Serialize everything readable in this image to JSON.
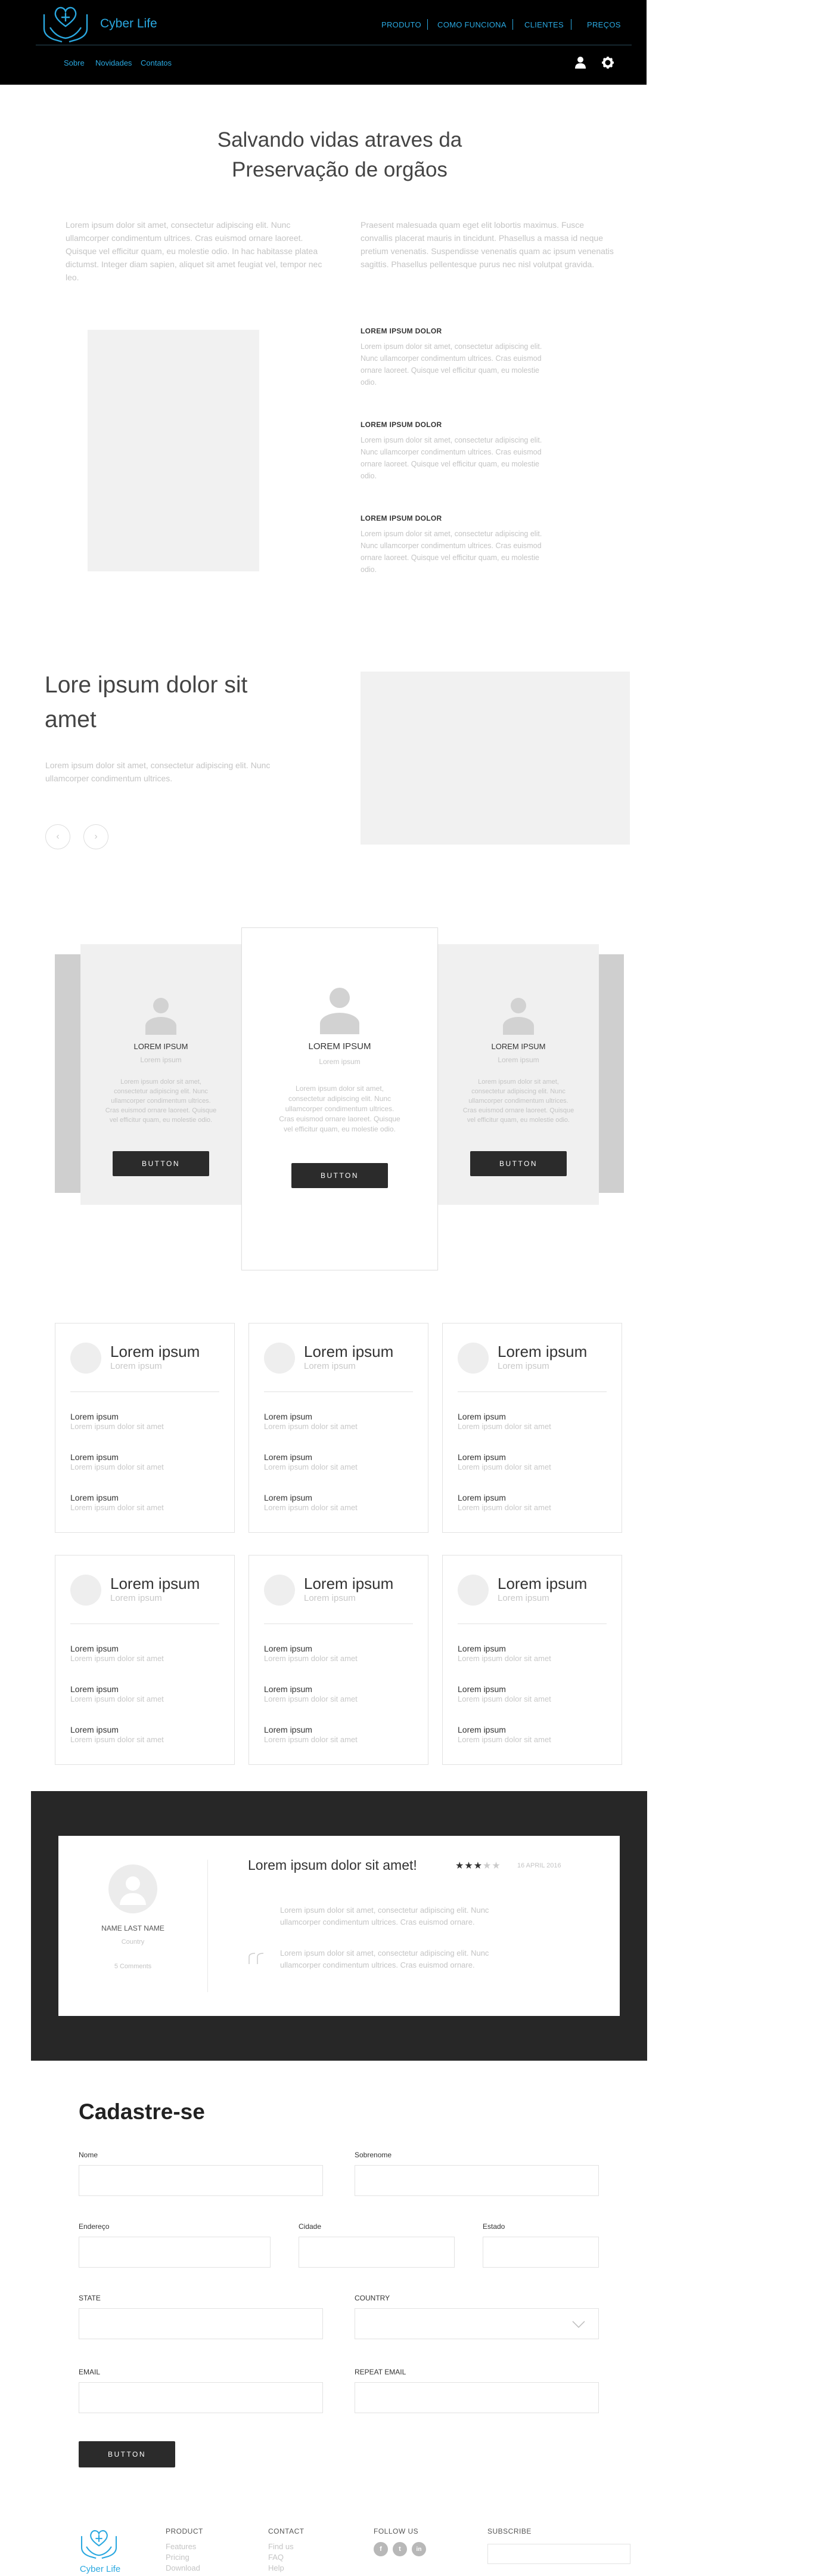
{
  "header": {
    "brand": "Cyber Life",
    "nav": [
      "PRODUTO",
      "COMO FUNCIONA",
      "CLIENTES",
      "PREÇOS"
    ],
    "subnav": [
      "Sobre",
      "Novidades",
      "Contatos"
    ],
    "icons": [
      "user-icon",
      "gear-icon"
    ],
    "accent": "#2aa8e0",
    "bg": "#000000"
  },
  "hero": {
    "title_line1": "Salvando vidas atraves da",
    "title_line2": "Preservação de orgãos",
    "para_left": "Lorem ipsum dolor sit amet, consectetur adipiscing elit. Nunc ullamcorper condimentum ultrices. Cras euismod ornare laoreet. Quisque vel efficitur quam, eu molestie odio. In hac habitasse platea dictumst. Integer diam sapien, aliquet sit amet feugiat vel, tempor nec leo.",
    "para_right": "Praesent malesuada quam eget elit lobortis maximus. Fusce convallis placerat mauris in tincidunt. Phasellus a massa id neque pretium venenatis. Suspendisse venenatis quam ac ipsum venenatis sagittis. Phasellus pellentesque purus nec nisl volutpat gravida.",
    "features": [
      {
        "title": "LOREM IPSUM DOLOR",
        "text": "Lorem ipsum dolor sit amet, consectetur adipiscing elit. Nunc ullamcorper condimentum ultrices. Cras euismod ornare laoreet. Quisque vel efficitur quam, eu molestie odio."
      },
      {
        "title": "LOREM IPSUM DOLOR",
        "text": "Lorem ipsum dolor sit amet, consectetur adipiscing elit. Nunc ullamcorper condimentum ultrices. Cras euismod ornare laoreet. Quisque vel efficitur quam, eu molestie odio."
      },
      {
        "title": "LOREM IPSUM DOLOR",
        "text": "Lorem ipsum dolor sit amet, consectetur adipiscing elit. Nunc ullamcorper condimentum ultrices. Cras euismod ornare laoreet. Quisque vel efficitur quam, eu molestie odio."
      }
    ]
  },
  "slider": {
    "title_line1": "Lore ipsum dolor sit",
    "title_line2": "amet",
    "text": "Lorem ipsum dolor sit amet, consectetur adipiscing elit. Nunc ullamcorper condimentum ultrices.",
    "prev": "‹",
    "next": "›"
  },
  "pricing": {
    "cards": [
      {
        "title": "LOREM IPSUM",
        "sub": "Lorem ipsum",
        "text": "Lorem ipsum dolor sit amet, consectetur adipiscing elit. Nunc ullamcorper condimentum ultrices. Cras euismod ornare laoreet. Quisque vel efficitur quam, eu molestie odio.",
        "button": "BUTTON"
      },
      {
        "title": "LOREM IPSUM",
        "sub": "Lorem ipsum",
        "text": "Lorem ipsum dolor sit amet, consectetur adipiscing elit. Nunc ullamcorper condimentum ultrices. Cras euismod ornare laoreet. Quisque vel efficitur quam, eu molestie odio.",
        "button": "BUTTON"
      },
      {
        "title": "LOREM IPSUM",
        "sub": "Lorem ipsum",
        "text": "Lorem ipsum dolor sit amet, consectetur adipiscing elit. Nunc ullamcorper condimentum ultrices. Cras euismod ornare laoreet. Quisque vel efficitur quam, eu molestie odio.",
        "button": "BUTTON"
      }
    ]
  },
  "list_cards": {
    "title": "Lorem ipsum",
    "sub": "Lorem ipsum",
    "item_title": "Lorem ipsum",
    "item_desc": "Lorem ipsum dolor sit amet"
  },
  "review": {
    "name": "NAME LAST NAME",
    "country": "Country",
    "comments": "5 Comments",
    "title": "Lorem ipsum dolor sit amet!",
    "stars": "★★★",
    "stars_empty": "★★",
    "rating": 3,
    "date": "16 APRIL 2016",
    "quote_icon": "quote-icon",
    "text1": "Lorem ipsum dolor sit amet, consectetur adipiscing elit. Nunc ullamcorper condimentum ultrices. Cras euismod ornare.",
    "text2": "Lorem ipsum dolor sit amet, consectetur adipiscing elit. Nunc ullamcorper condimentum ultrices. Cras euismod ornare."
  },
  "form": {
    "title": "Cadastre-se",
    "labels": {
      "nome": "Nome",
      "sobrenome": "Sobrenome",
      "endereco": "Endereço",
      "cidade": "Cidade",
      "estado": "Estado",
      "state": "STATE",
      "country": "COUNTRY",
      "email": "EMAIL",
      "repeat_email": "REPEAT EMAIL"
    },
    "button": "BUTTON"
  },
  "footer": {
    "brand": "Cyber Life",
    "product_head": "PRODUCT",
    "product_links": [
      "Features",
      "Pricing",
      "Download"
    ],
    "contact_head": "CONTACT",
    "contact_links": [
      "Find us",
      "FAQ",
      "Help"
    ],
    "follow_head": "FOLLOW US",
    "social": [
      "f",
      "t",
      "in"
    ],
    "subscribe_head": "SUBSCRIBE"
  }
}
